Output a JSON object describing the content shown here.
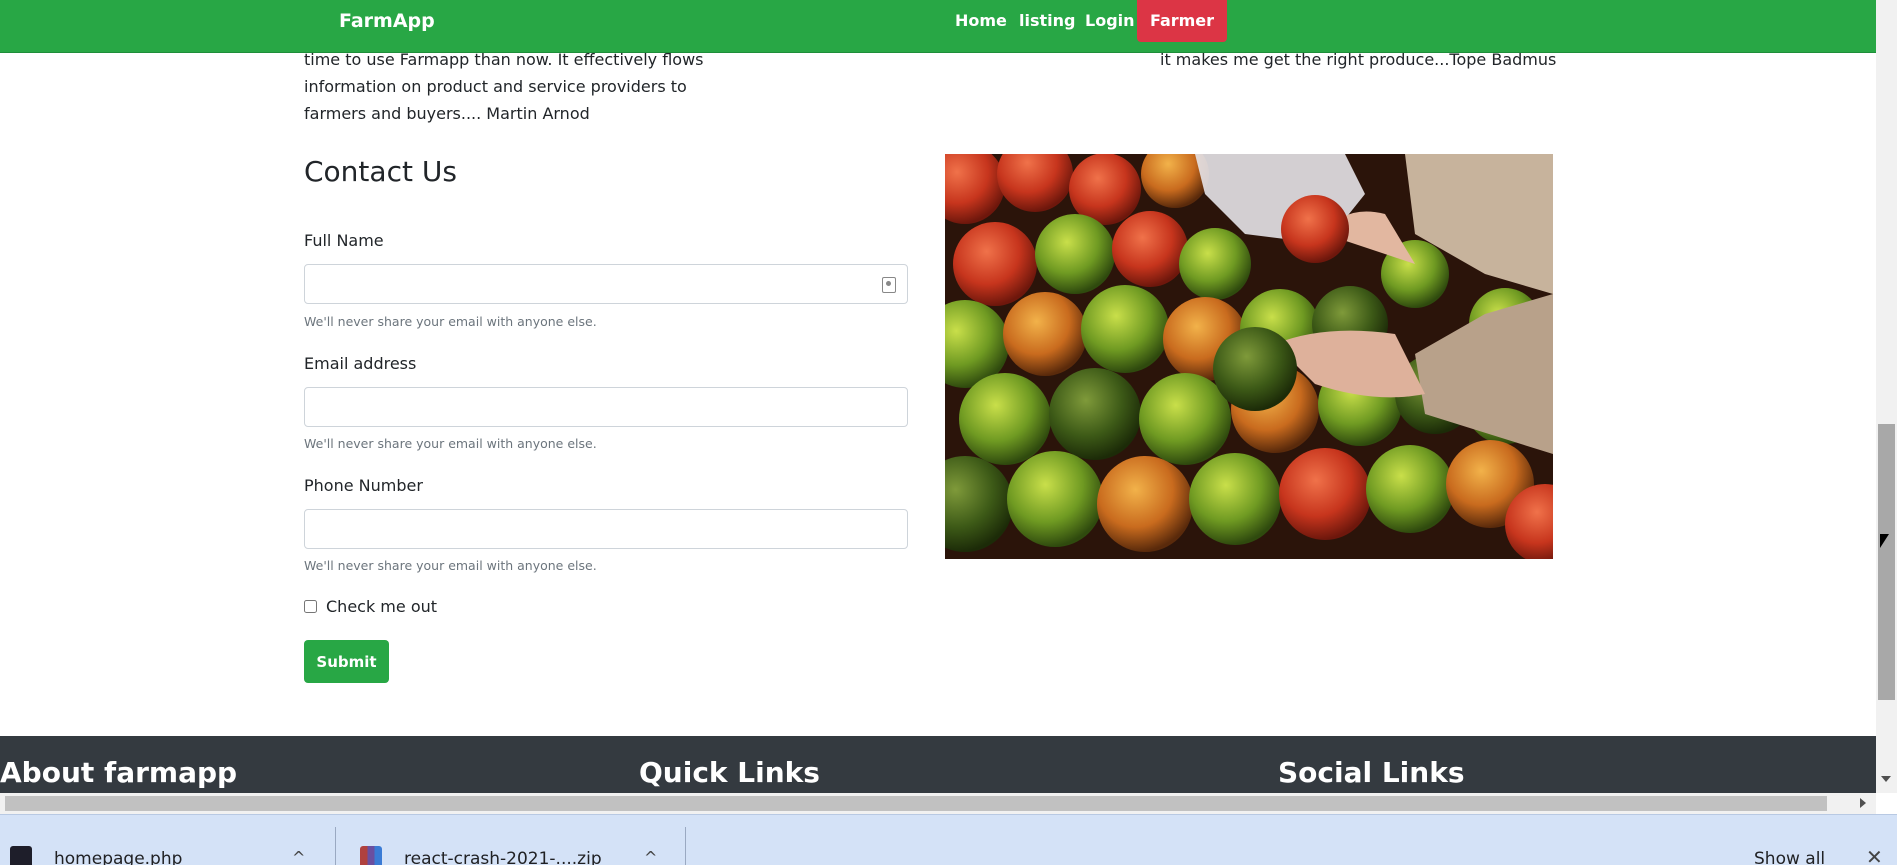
{
  "navbar": {
    "brand": "FarmApp",
    "links": [
      "Home",
      "listing",
      "Login"
    ],
    "farmer_button": "Farmer"
  },
  "testimonials": {
    "left_lines": [
      "time to use Farmapp than now. It effectively flows",
      "information on product and service providers to",
      "farmers and buyers.... Martin Arnod"
    ],
    "right_line": "it makes me get the right produce...Tope Badmus"
  },
  "contact": {
    "title": "Contact Us",
    "fields": [
      {
        "label": "Full Name",
        "value": "",
        "help": "We'll never share your email with anyone else."
      },
      {
        "label": "Email address",
        "value": "",
        "help": "We'll never share your email with anyone else."
      },
      {
        "label": "Phone Number",
        "value": "",
        "help": "We'll never share your email with anyone else."
      }
    ],
    "checkbox_label": "Check me out",
    "submit_label": "Submit"
  },
  "footer": {
    "headings": [
      "About farmapp",
      "Quick Links",
      "Social Links"
    ]
  },
  "downloads": {
    "items": [
      {
        "name": "homepage.php",
        "icon": "phpstorm-file-icon"
      },
      {
        "name": "react-crash-2021-....zip",
        "icon": "archive-file-icon"
      }
    ],
    "show_all": "Show all"
  },
  "colors": {
    "navbar": "#28a745",
    "farmer_button": "#dc3545",
    "submit": "#28a745",
    "footer": "#343a40",
    "download_bar": "#d4e2f7"
  }
}
